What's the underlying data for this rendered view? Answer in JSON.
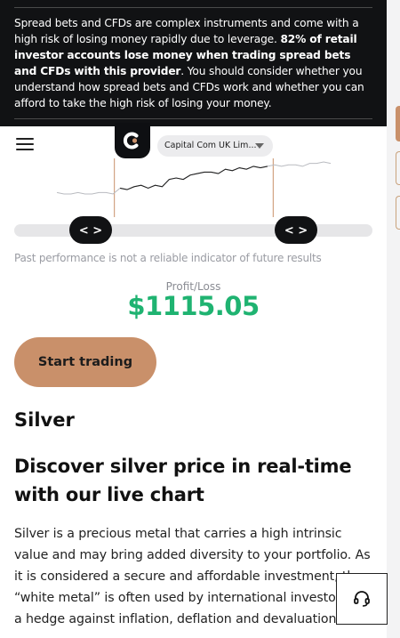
{
  "risk_warning": {
    "part1": "Spread bets and CFDs are complex instruments and come with a high risk of losing money rapidly due to leverage. ",
    "bold": "82% of retail investor accounts lose money when trading spread bets and CFDs with this provider",
    "part2": ". You should consider whether you understand how spread bets and CFDs work and whether you can afford to take the high risk of losing your money."
  },
  "header": {
    "menu_icon": "hamburger-menu-icon",
    "logo_icon": "capital-com-logo",
    "entity_selector": "Capital Com UK Lim...",
    "caret_icon": "caret-down-icon"
  },
  "chart_data": {
    "type": "line",
    "x": [
      0,
      1,
      2,
      3,
      4,
      5,
      6,
      7,
      8,
      9,
      10,
      11,
      12,
      13,
      14,
      15,
      16,
      17,
      18,
      19,
      20,
      21,
      22,
      23,
      24,
      25,
      26,
      27,
      28,
      29,
      30,
      31,
      32,
      33,
      34,
      35,
      36,
      37,
      38,
      39
    ],
    "values": [
      30,
      31,
      31,
      30,
      31,
      31,
      30,
      30,
      31,
      27,
      28,
      26,
      25,
      27,
      25,
      26,
      21,
      20,
      21,
      18,
      17,
      16,
      16,
      17,
      14,
      15,
      13,
      14,
      12,
      13,
      12,
      11,
      12,
      11,
      11,
      12,
      10,
      10,
      9,
      10
    ],
    "slider_left_label": "< >",
    "slider_right_label": "< >",
    "range_start_fraction": 0.21,
    "range_end_fraction": 0.79,
    "accent_color": "#c9906a"
  },
  "disclaimer": "Past performance is not a reliable indicator of future results",
  "profit_loss": {
    "label": "Profit/Loss",
    "value": "$1115.05",
    "color": "#1fb371"
  },
  "cta": {
    "label": "Start trading"
  },
  "content": {
    "title": "Silver",
    "subtitle": "Discover silver price in real-time with our live chart",
    "body": "Silver is a precious metal that carries a high intrinsic value and may bring added diversity to your portfolio. As it is considered a secure and affordable investment, the “white metal” is often used by international investors as a hedge against inflation, deflation and devaluation."
  },
  "support": {
    "icon": "headset-support-icon"
  }
}
